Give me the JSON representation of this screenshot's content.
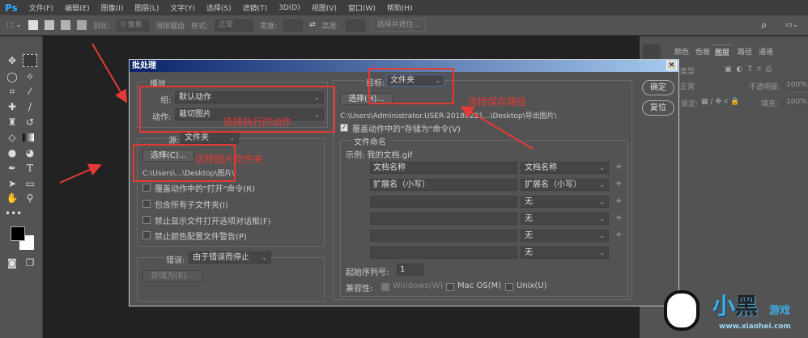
{
  "app": {
    "logo": "Ps",
    "menu": [
      "文件(F)",
      "编辑(E)",
      "图像(I)",
      "图层(L)",
      "文字(Y)",
      "选择(S)",
      "滤镜(T)",
      "3D(D)",
      "视图(V)",
      "窗口(W)",
      "帮助(H)"
    ]
  },
  "options": {
    "feather_label": "羽化:",
    "feather_value": "0 像素",
    "antialias": "消除锯齿",
    "style_label": "样式:",
    "style_value": "正常",
    "width_label": "宽度:",
    "height_label": "高度:",
    "select_mask": "选择并遮住..."
  },
  "right_panel": {
    "tabs": [
      "颜色",
      "色板",
      "图层",
      "路径",
      "通道"
    ],
    "kind": "类型",
    "mode": "正常",
    "opacity_label": "不透明度:",
    "opacity": "100%",
    "lock_label": "锁定:",
    "fill_label": "填充:",
    "fill": "100%"
  },
  "dialog": {
    "title": "批处理",
    "close": "✕",
    "ok": "确定",
    "reset": "复位",
    "play": {
      "legend": "播放",
      "group_label": "组:",
      "group_value": "默认动作",
      "action_label": "动作:",
      "action_value": "裁切图片"
    },
    "source": {
      "label": "源:",
      "value": "文件夹",
      "choose": "选择(C)...",
      "path": "C:\\Users\\...\\Desktop\\图片\\",
      "checks": [
        {
          "label": "覆盖动作中的\"打开\"命令(R)",
          "checked": false
        },
        {
          "label": "包含所有子文件夹(I)",
          "checked": false
        },
        {
          "label": "禁止显示文件打开选项对话框(F)",
          "checked": false
        },
        {
          "label": "禁止颜色配置文件警告(P)",
          "checked": false
        }
      ]
    },
    "errors": {
      "label": "错误:",
      "value": "由于错误而停止",
      "save_as": "存储为(E)..."
    },
    "dest": {
      "label": "目标:",
      "value": "文件夹",
      "choose": "选择(H)...",
      "path": "C:\\Users\\Administrator.USER-20180221...\\Desktop\\导出图片\\",
      "override": "覆盖动作中的\"存储为\"命令(V)",
      "override_checked": true
    },
    "naming": {
      "legend": "文件命名",
      "example": "示例: 我的文档.gif",
      "rows": [
        {
          "text": "文档名称",
          "select": "文档名称",
          "plus": "+"
        },
        {
          "text": "扩展名（小写）",
          "select": "扩展名（小写）",
          "plus": "+"
        },
        {
          "text": "",
          "select": "无",
          "plus": "+"
        },
        {
          "text": "",
          "select": "无",
          "plus": "+"
        },
        {
          "text": "",
          "select": "无",
          "plus": "+"
        },
        {
          "text": "",
          "select": "无",
          "plus": ""
        }
      ],
      "serial_label": "起始序列号:",
      "serial": "1",
      "compat_label": "兼容性:",
      "windows": "Windows(W)",
      "mac": "Mac OS(M)",
      "unix": "Unix(U)"
    }
  },
  "annotations": {
    "actions": "选择执行的动作",
    "folder": "选择图片文件夹",
    "save": "选择保存路径",
    "color": "#e53935"
  },
  "watermark": {
    "name": "小黑游戏",
    "url": "www.xiaohei.com"
  }
}
